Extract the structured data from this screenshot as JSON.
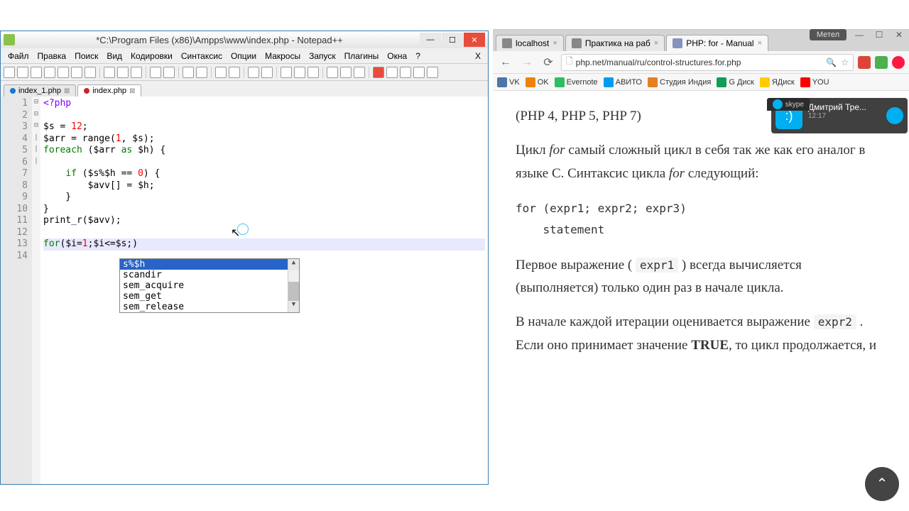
{
  "notepadpp": {
    "title": "*C:\\Program Files (x86)\\Ampps\\www\\index.php - Notepad++",
    "menu": [
      "Файл",
      "Правка",
      "Поиск",
      "Вид",
      "Кодировки",
      "Синтаксис",
      "Опции",
      "Макросы",
      "Запуск",
      "Плагины",
      "Окна",
      "?"
    ],
    "tabs": [
      {
        "label": "index_1.php",
        "active": false
      },
      {
        "label": "index.php",
        "active": true
      }
    ],
    "lines": [
      "1",
      "2",
      "3",
      "4",
      "5",
      "6",
      "7",
      "8",
      "9",
      "10",
      "11",
      "12",
      "13",
      "14"
    ],
    "autocomplete": {
      "items": [
        "s%$h",
        "scandir",
        "sem_acquire",
        "sem_get",
        "sem_release"
      ],
      "selected": 0
    }
  },
  "browser": {
    "tabs": [
      {
        "label": "localhost",
        "active": false
      },
      {
        "label": "Практика на раб",
        "active": false
      },
      {
        "label": "PHP: for - Manual",
        "active": true
      }
    ],
    "url": "php.net/manual/ru/control-structures.for.php",
    "bookmarks": [
      {
        "label": "VK",
        "color": "#4a76a8"
      },
      {
        "label": "OK",
        "color": "#ee8208"
      },
      {
        "label": "Evernote",
        "color": "#2dbe60"
      },
      {
        "label": "АВИТО",
        "color": "#009cf0"
      },
      {
        "label": "Студия Индия",
        "color": "#e67e22"
      },
      {
        "label": "G Диск",
        "color": "#0f9d58"
      },
      {
        "label": "ЯДиск",
        "color": "#ffcc00"
      },
      {
        "label": "YOU",
        "color": "#ff0000"
      }
    ],
    "content": {
      "versions": "(PHP 4, PHP 5, PHP 7)",
      "p1a": "Цикл ",
      "p1b": " самый сложный цикл в себя так же как его аналог в языке C. Синтаксис цикла ",
      "p1c": " следующий:",
      "for_kw": "for",
      "code1": "for (expr1; expr2; expr3)",
      "code2": "    statement",
      "p2a": "Первое выражение ( ",
      "p2b": " ) всегда вычисляется (выполняется) только один раз в начале цикла.",
      "expr1": "expr1",
      "p3a": "В начале каждой итерации оценивается выражение ",
      "p3b": " . Если оно принимает значение ",
      "p3c": ", то цикл продолжается, и",
      "expr2": "expr2",
      "true_kw": "TRUE"
    }
  },
  "overlays": {
    "metel": "Метел",
    "skype_label": "skype",
    "skype_name": "Дмитрий Тре...",
    "skype_time": "12:17"
  }
}
